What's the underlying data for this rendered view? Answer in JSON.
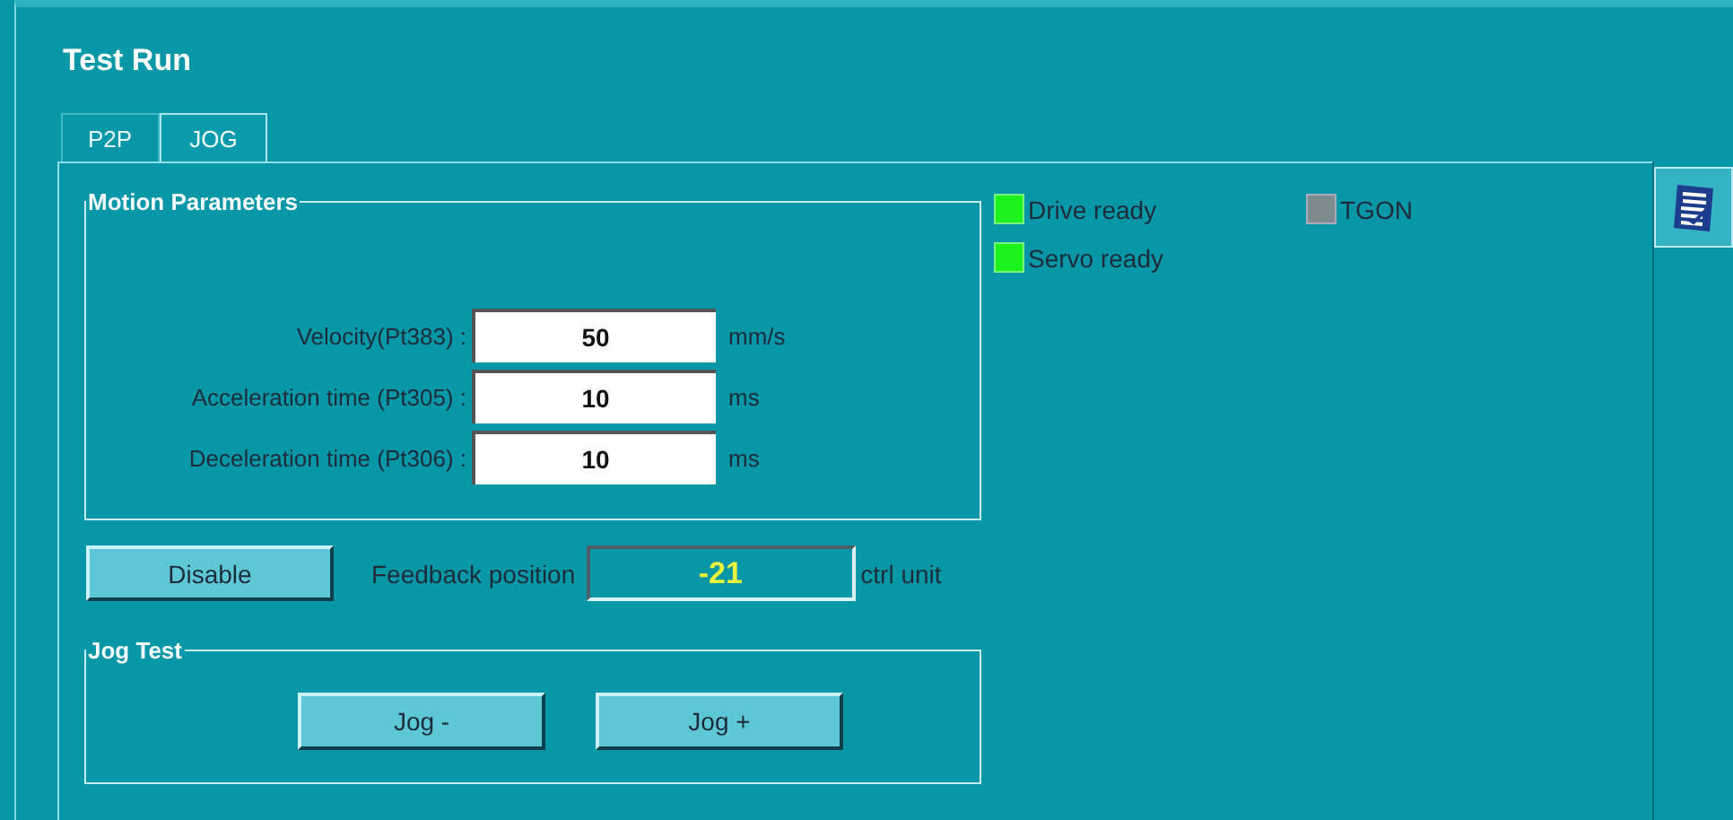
{
  "window": {
    "title": "Test Run"
  },
  "tabs": [
    {
      "label": "P2P",
      "selected": false
    },
    {
      "label": "JOG",
      "selected": true
    }
  ],
  "motion_parameters": {
    "title": "Motion Parameters",
    "fields": [
      {
        "label": "Velocity(Pt383) :",
        "value": "50",
        "unit": "mm/s"
      },
      {
        "label": "Acceleration time (Pt305) :",
        "value": "10",
        "unit": "ms"
      },
      {
        "label": "Deceleration time (Pt306) :",
        "value": "10",
        "unit": "ms"
      }
    ]
  },
  "disable_button": "Disable",
  "feedback": {
    "label": "Feedback position",
    "value": "-21",
    "unit": "ctrl unit"
  },
  "jog_test": {
    "title": "Jog Test",
    "buttons": [
      "Jog -",
      "Jog +"
    ]
  },
  "status": [
    {
      "label": "Drive ready",
      "on": true
    },
    {
      "label": "TGON",
      "on": false
    },
    {
      "label": "Servo ready",
      "on": true
    }
  ]
}
